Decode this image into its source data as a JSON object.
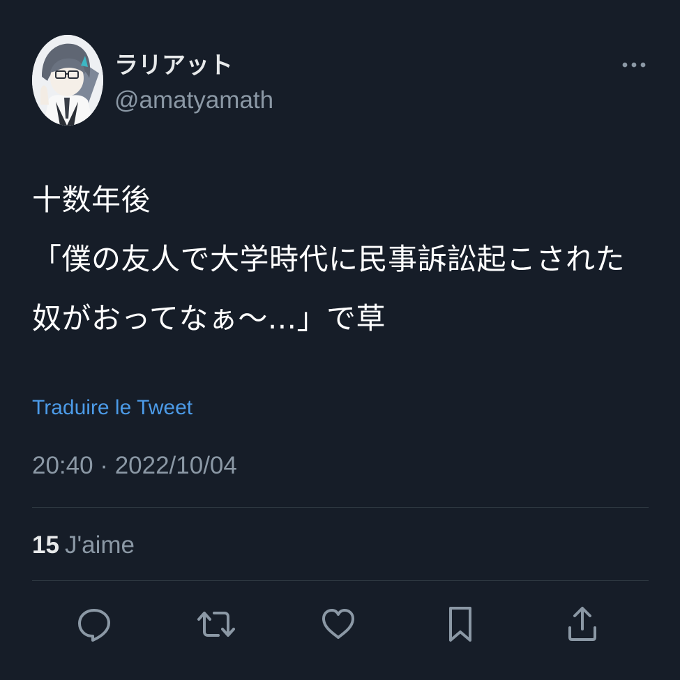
{
  "user": {
    "display_name": "ラリアット",
    "handle": "@amatyamath",
    "avatar_icon": "avatar-anime-character"
  },
  "tweet": {
    "lines": [
      "十数年後",
      "「僕の友人で大学時代に民事訴訟起こされた",
      "奴がおってなぁ〜...」で草"
    ],
    "translate_label": "Traduire le Tweet",
    "timestamp": "20:40 · 2022/10/04"
  },
  "stats": {
    "likes_count": "15",
    "likes_label": "J'aime"
  },
  "actions": [
    "reply-icon",
    "retweet-icon",
    "like-icon",
    "bookmark-icon",
    "share-icon"
  ],
  "colors": {
    "background": "#161d28",
    "text": "#e7e9ea",
    "secondary": "#8b98a5",
    "link": "#4c9be8",
    "divider": "#2f3942"
  }
}
